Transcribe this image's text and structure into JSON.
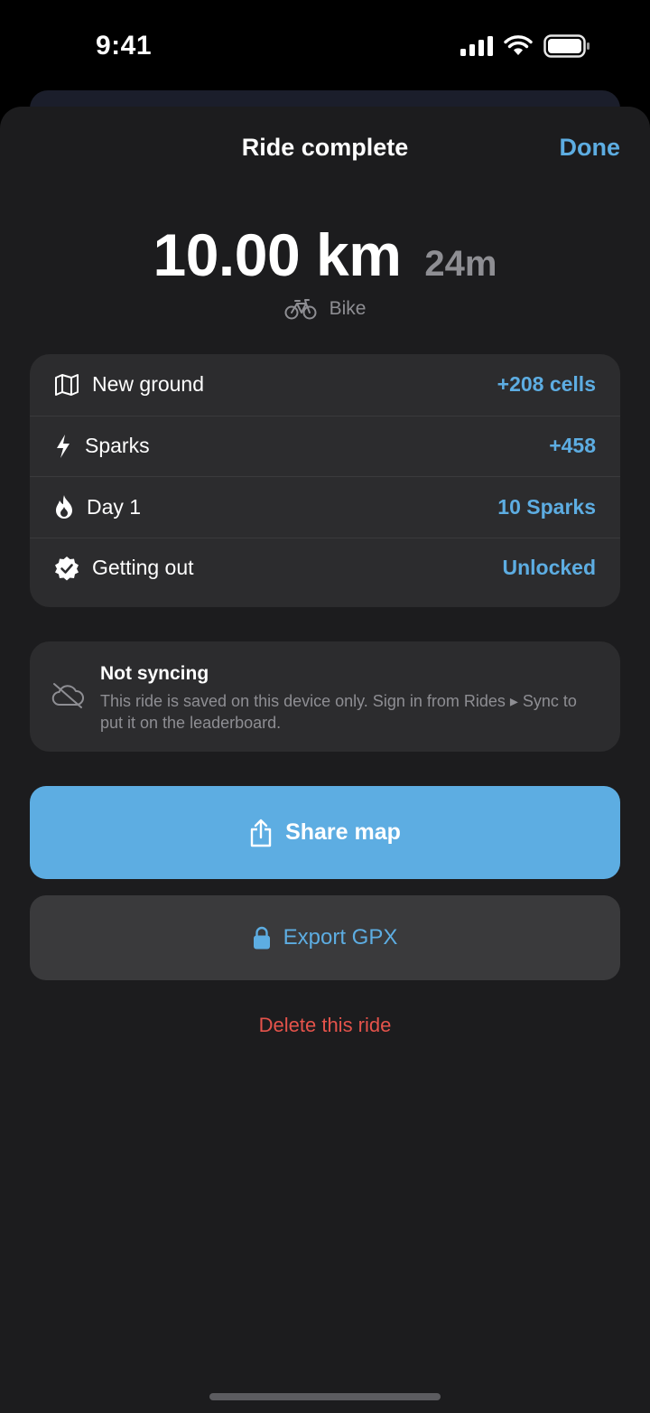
{
  "status_bar": {
    "time": "9:41"
  },
  "header": {
    "title": "Ride complete",
    "done_label": "Done"
  },
  "summary": {
    "distance": "10.00 km",
    "duration": "24m",
    "mode_label": "Bike",
    "mode_icon": "bike-icon"
  },
  "stats": [
    {
      "icon": "map-icon",
      "label": "New ground",
      "value": "+208 cells"
    },
    {
      "icon": "bolt-icon",
      "label": "Sparks",
      "value": "+458"
    },
    {
      "icon": "flame-icon",
      "label": "Day 1",
      "value": "10 Sparks"
    },
    {
      "icon": "verified-badge-icon",
      "label": "Getting out",
      "value": "Unlocked"
    }
  ],
  "sync_notice": {
    "icon": "cloud-off-icon",
    "title": "Not syncing",
    "body": "This ride is saved on this device only. Sign in from Rides ▸ Sync to put it on the leaderboard."
  },
  "actions": {
    "share_label": "Share map",
    "share_icon": "share-icon",
    "export_label": "Export GPX",
    "export_icon": "lock-icon",
    "delete_label": "Delete this ride"
  },
  "colors": {
    "accent": "#5dade2",
    "danger": "#e5534b",
    "sheet": "#1c1c1e",
    "card": "#2c2c2e"
  }
}
